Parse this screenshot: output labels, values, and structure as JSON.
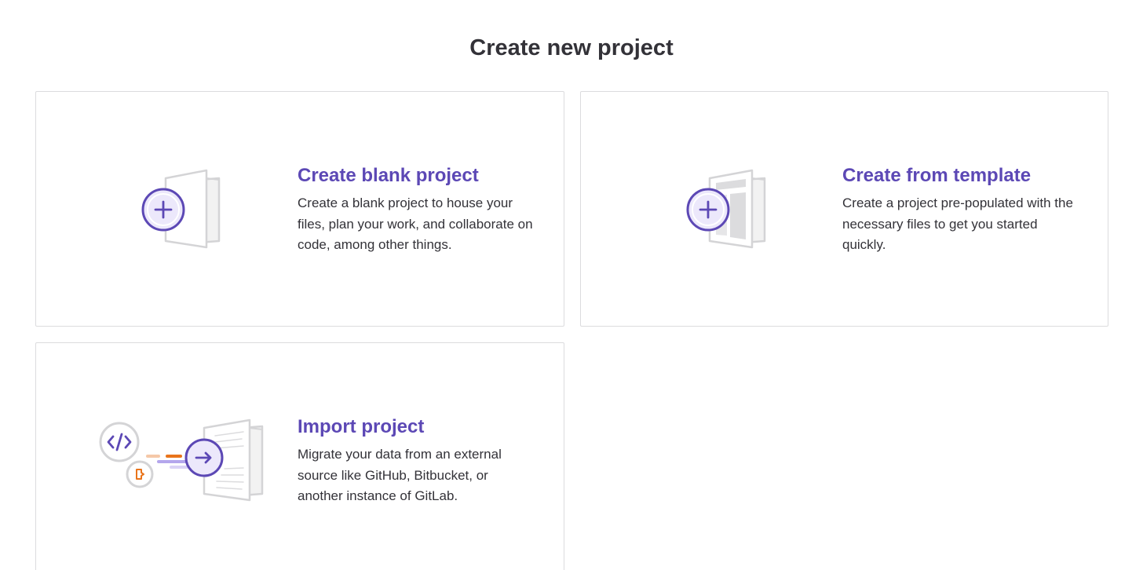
{
  "page": {
    "title": "Create new project"
  },
  "cards": [
    {
      "title": "Create blank project",
      "description": "Create a blank project to house your files, plan your work, and collaborate on code, among other things.",
      "icon": "blank-project-illustration"
    },
    {
      "title": "Create from template",
      "description": "Create a project pre-populated with the necessary files to get you started quickly.",
      "icon": "template-project-illustration"
    },
    {
      "title": "Import project",
      "description": "Migrate your data from an external source like GitHub, Bitbucket, or another instance of GitLab.",
      "icon": "import-project-illustration"
    }
  ],
  "colors": {
    "accent": "#5c48b5",
    "accent_fill": "#ece8fb",
    "border": "#dcdcde",
    "illustration_gray": "#d4d4d6",
    "orange": "#e9741b"
  }
}
